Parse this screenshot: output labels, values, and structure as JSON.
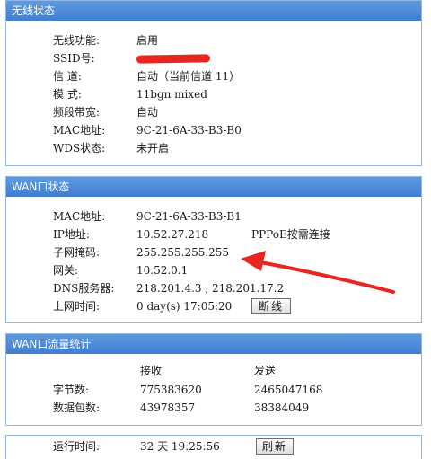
{
  "wireless": {
    "header": "无线状态",
    "rows": [
      {
        "label": "无线功能:",
        "value": "启用"
      },
      {
        "label": "SSID号:",
        "value": ""
      },
      {
        "label": "信 道:",
        "value": "自动（当前信道 11）"
      },
      {
        "label": "模 式:",
        "value": "11bgn mixed"
      },
      {
        "label": "频段带宽:",
        "value": "自动"
      },
      {
        "label": "MAC地址:",
        "value": "9C-21-6A-33-B3-B0"
      },
      {
        "label": "WDS状态:",
        "value": "未开启"
      }
    ]
  },
  "wan": {
    "header": "WAN口状态",
    "rows": [
      {
        "label": "MAC地址:",
        "value": "9C-21-6A-33-B3-B1"
      },
      {
        "label": "IP地址:",
        "value": "10.52.27.218",
        "extra": "PPPoE按需连接"
      },
      {
        "label": "子网掩码:",
        "value": "255.255.255.255"
      },
      {
        "label": "网关:",
        "value": "10.52.0.1"
      },
      {
        "label": "DNS服务器:",
        "value": "218.201.4.3 , 218.201.17.2"
      },
      {
        "label": "上网时间:",
        "value": "0 day(s) 17:05:20"
      }
    ],
    "disconnect_label": "断线"
  },
  "traffic": {
    "header": "WAN口流量统计",
    "col_recv": "接收",
    "col_send": "发送",
    "rows": [
      {
        "label": "字节数:",
        "recv": "775383620",
        "send": "2465047168"
      },
      {
        "label": "数据包数:",
        "recv": "43978357",
        "send": "38384049"
      }
    ]
  },
  "footer": {
    "label": "运行时间:",
    "value": "32 天 19:25:56",
    "refresh_label": "刷新"
  },
  "colors": {
    "header_bg": "#4a88d6",
    "panel_border": "#8fb6e6",
    "annotation": "#e8261f"
  }
}
